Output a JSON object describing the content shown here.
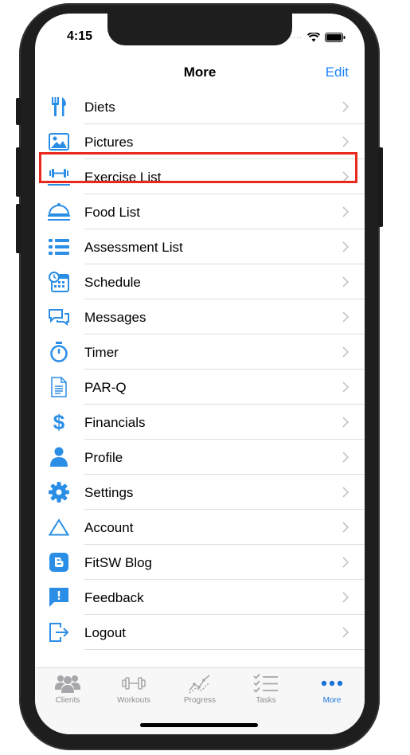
{
  "status": {
    "time": "4:15"
  },
  "nav": {
    "title": "More",
    "edit_label": "Edit"
  },
  "menu": [
    {
      "label": "Diets",
      "icon": "fork-knife-icon"
    },
    {
      "label": "Pictures",
      "icon": "picture-icon"
    },
    {
      "label": "Exercise List",
      "icon": "dumbbell-icon"
    },
    {
      "label": "Food List",
      "icon": "cloche-icon"
    },
    {
      "label": "Assessment List",
      "icon": "list-icon"
    },
    {
      "label": "Schedule",
      "icon": "calendar-clock-icon"
    },
    {
      "label": "Messages",
      "icon": "chat-bubbles-icon"
    },
    {
      "label": "Timer",
      "icon": "stopwatch-icon"
    },
    {
      "label": "PAR-Q",
      "icon": "document-icon"
    },
    {
      "label": "Financials",
      "icon": "dollar-icon"
    },
    {
      "label": "Profile",
      "icon": "person-icon"
    },
    {
      "label": "Settings",
      "icon": "gear-icon"
    },
    {
      "label": "Account",
      "icon": "triangle-icon"
    },
    {
      "label": "FitSW Blog",
      "icon": "blogger-icon"
    },
    {
      "label": "Feedback",
      "icon": "feedback-icon"
    },
    {
      "label": "Logout",
      "icon": "logout-icon"
    }
  ],
  "tabs": [
    {
      "label": "Clients",
      "icon": "people-icon",
      "active": false
    },
    {
      "label": "Workouts",
      "icon": "dumbbell-icon",
      "active": false
    },
    {
      "label": "Progress",
      "icon": "chart-line-icon",
      "active": false
    },
    {
      "label": "Tasks",
      "icon": "checklist-icon",
      "active": false
    },
    {
      "label": "More",
      "icon": "more-dots-icon",
      "active": true
    }
  ],
  "colors": {
    "accent": "#1a82fb",
    "icon_blue": "#2a8ee6",
    "highlight": "#e8281d"
  }
}
